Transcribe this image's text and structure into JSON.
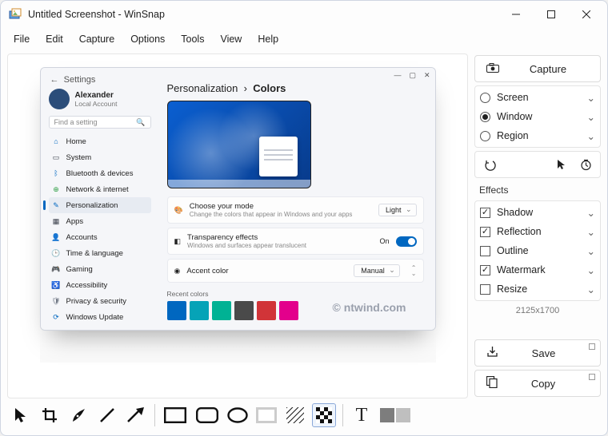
{
  "titlebar": {
    "title": "Untitled Screenshot - WinSnap"
  },
  "menu": {
    "file": "File",
    "edit": "Edit",
    "capture": "Capture",
    "options": "Options",
    "tools": "Tools",
    "view": "View",
    "help": "Help"
  },
  "sidebar": {
    "capture_btn": "Capture",
    "modes": {
      "screen": "Screen",
      "window": "Window",
      "region": "Region"
    },
    "effects_title": "Effects",
    "effects": {
      "shadow": "Shadow",
      "reflection": "Reflection",
      "outline": "Outline",
      "watermark": "Watermark",
      "resize": "Resize"
    },
    "dimensions": "2125x1700",
    "save": "Save",
    "copy": "Copy"
  },
  "shot": {
    "app": "Settings",
    "user": {
      "name": "Alexander",
      "type": "Local Account"
    },
    "search_placeholder": "Find a setting",
    "breadcrumb": {
      "root": "Personalization",
      "sep": "›",
      "current": "Colors"
    },
    "nav": [
      {
        "label": "Home",
        "color": "#0067c0",
        "glyph": "⌂"
      },
      {
        "label": "System",
        "color": "#3a3f4b",
        "glyph": "▭"
      },
      {
        "label": "Bluetooth & devices",
        "color": "#0067c0",
        "glyph": "ᛒ"
      },
      {
        "label": "Network & internet",
        "color": "#2f9e44",
        "glyph": "⊕"
      },
      {
        "label": "Personalization",
        "color": "#0067c0",
        "glyph": "✎",
        "active": true
      },
      {
        "label": "Apps",
        "color": "#3a3f4b",
        "glyph": "▦"
      },
      {
        "label": "Accounts",
        "color": "#3a7bd5",
        "glyph": "👤"
      },
      {
        "label": "Time & language",
        "color": "#d67b1f",
        "glyph": "🕒"
      },
      {
        "label": "Gaming",
        "color": "#2f9e44",
        "glyph": "🎮"
      },
      {
        "label": "Accessibility",
        "color": "#0067c0",
        "glyph": "♿"
      },
      {
        "label": "Privacy & security",
        "color": "#6b7280",
        "glyph": "🛡"
      },
      {
        "label": "Windows Update",
        "color": "#0067c0",
        "glyph": "⟳"
      }
    ],
    "cards": {
      "mode": {
        "title": "Choose your mode",
        "desc": "Change the colors that appear in Windows and your apps",
        "value": "Light"
      },
      "transparency": {
        "title": "Transparency effects",
        "desc": "Windows and surfaces appear translucent",
        "value": "On"
      },
      "accent": {
        "title": "Accent color",
        "value": "Manual"
      },
      "recent_label": "Recent colors",
      "swatches": [
        "#0067c0",
        "#06a3b7",
        "#00b294",
        "#4a4a4a",
        "#d13438",
        "#e3008c"
      ]
    },
    "watermark": "© ntwind.com"
  }
}
